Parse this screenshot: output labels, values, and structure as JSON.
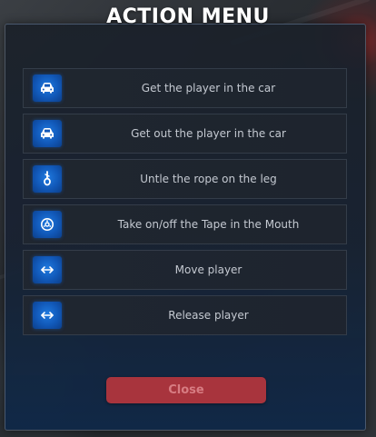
{
  "window": {
    "title": "ACTION MENU"
  },
  "menu": {
    "items": [
      {
        "label": "Get the player in the car",
        "icon": "car-icon"
      },
      {
        "label": "Get out the player in the car",
        "icon": "car-icon"
      },
      {
        "label": "Untle the rope on the leg",
        "icon": "rope-icon"
      },
      {
        "label": "Take on/off the Tape in the Mouth",
        "icon": "tape-icon"
      },
      {
        "label": "Move player",
        "icon": "move-arrows-icon"
      },
      {
        "label": "Release player",
        "icon": "move-arrows-icon"
      }
    ]
  },
  "footer": {
    "close_label": "Close"
  },
  "colors": {
    "accent_blue": "#1f7ae0",
    "close_button": "#a8343d",
    "close_text": "#d77c82"
  }
}
